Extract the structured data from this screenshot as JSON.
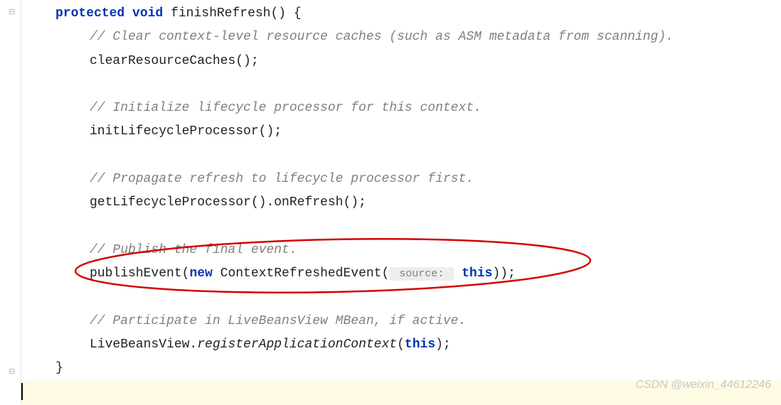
{
  "code": {
    "protected": "protected",
    "void": "void",
    "methodName": "finishRefresh",
    "openParen": "()",
    "openBrace": " {",
    "comment1": "// Clear context-level resource caches (such as ASM metadata from scanning).",
    "call1": "clearResourceCaches();",
    "comment2": "// Initialize lifecycle processor for this context.",
    "call2": "initLifecycleProcessor();",
    "comment3": "// Propagate refresh to lifecycle processor first.",
    "call3": "getLifecycleProcessor().onRefresh();",
    "comment4": "// Publish the final event.",
    "call4_publishEvent": "publishEvent(",
    "call4_new": "new",
    "call4_contextRefreshedEvent": " ContextRefreshedEvent(",
    "call4_paramHint": " source: ",
    "call4_this": "this",
    "call4_close": "));",
    "comment5": "// Participate in LiveBeansView MBean, if active.",
    "call5_liveBeansView": "LiveBeansView.",
    "call5_registerApplicationContext": "registerApplicationContext",
    "call5_open": "(",
    "call5_this": "this",
    "call5_close": ");",
    "closeBrace": "}"
  },
  "watermark": "CSDN @weixin_44612246"
}
